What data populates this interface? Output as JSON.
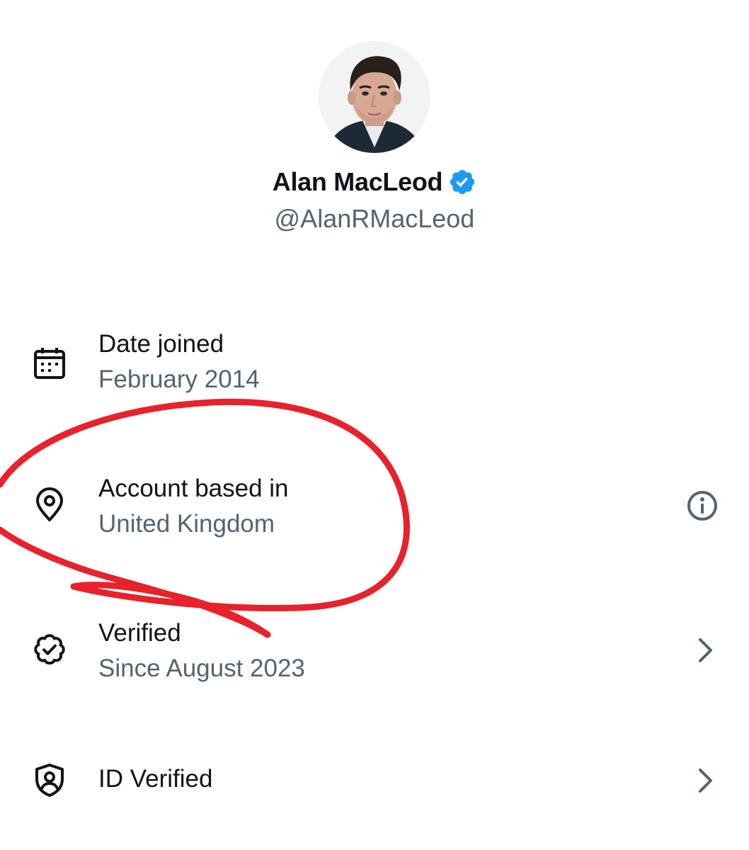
{
  "profile": {
    "display_name": "Alan MacLeod",
    "handle": "@AlanRMacLeod"
  },
  "rows": [
    {
      "icon": "calendar-icon",
      "title": "Date joined",
      "value": "February 2014"
    },
    {
      "icon": "location-pin-icon",
      "title": "Account based in",
      "value": "United Kingdom",
      "trailing_icon": "info-icon"
    },
    {
      "icon": "verified-badge-outline-icon",
      "title": "Verified",
      "value": "Since August 2023",
      "trailing_icon": "chevron-right-icon"
    },
    {
      "icon": "id-shield-icon",
      "title": "ID Verified",
      "trailing_icon": "chevron-right-icon"
    }
  ],
  "colors": {
    "primary_text": "#0f1419",
    "secondary_text": "#536471",
    "verified_blue": "#1d9bf0",
    "annotation_red": "#e8212b",
    "background": "#ffffff"
  }
}
